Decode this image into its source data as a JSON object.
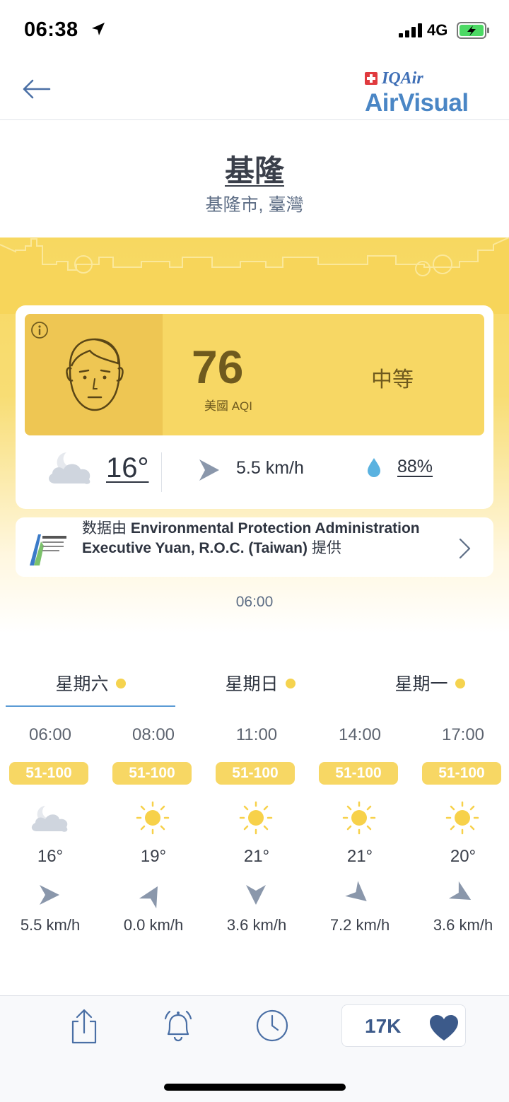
{
  "status_bar": {
    "time": "06:38",
    "network": "4G",
    "icons": [
      "location-arrow-icon",
      "signal-bars-icon",
      "battery-charging-icon"
    ]
  },
  "header": {
    "back_icon": "back-arrow-icon",
    "logo_top": "IQAir",
    "logo_bottom": "AirVisual",
    "colors": {
      "logo_blue": "#4a86c5",
      "flag_red": "#e03a3e"
    }
  },
  "location": {
    "city": "基隆",
    "region": "基隆市, 臺灣"
  },
  "aqi": {
    "value": "76",
    "unit": "美國 AQI",
    "level": "中等",
    "color": "#f7d764",
    "face_icon": "neutral-face-icon",
    "info_icon": "info-icon"
  },
  "current_weather": {
    "condition_icon": "partly-cloudy-night-icon",
    "temperature": "16°",
    "wind_icon": "wind-direction-icon",
    "wind_speed": "5.5 km/h",
    "humidity_icon": "water-drop-icon",
    "humidity": "88%"
  },
  "source": {
    "prefix": "数据由 ",
    "name": "Environmental Protection Administration Executive Yuan, R.O.C. (Taiwan)",
    "suffix": " 提供",
    "logo_icon": "epa-logo-icon",
    "chevron_icon": "chevron-right-icon"
  },
  "last_update": "06:00",
  "day_tabs": [
    {
      "label": "星期六",
      "active": true
    },
    {
      "label": "星期日",
      "active": false
    },
    {
      "label": "星期一",
      "active": false
    }
  ],
  "hourly": [
    {
      "time": "06:00",
      "aqi_range": "51-100",
      "icon": "partly-cloudy-night-icon",
      "temp": "16°",
      "wind": "5.5 km/h",
      "wind_dir_deg": 0
    },
    {
      "time": "08:00",
      "aqi_range": "51-100",
      "icon": "sun-icon",
      "temp": "19°",
      "wind": "0.0 km/h",
      "wind_dir_deg": -60
    },
    {
      "time": "11:00",
      "aqi_range": "51-100",
      "icon": "sun-icon",
      "temp": "21°",
      "wind": "3.6 km/h",
      "wind_dir_deg": 90
    },
    {
      "time": "14:00",
      "aqi_range": "51-100",
      "icon": "sun-icon",
      "temp": "21°",
      "wind": "7.2 km/h",
      "wind_dir_deg": 40
    },
    {
      "time": "17:00",
      "aqi_range": "51-100",
      "icon": "sun-icon",
      "temp": "20°",
      "wind": "3.6 km/h",
      "wind_dir_deg": 30
    }
  ],
  "bottom_bar": {
    "share_icon": "share-icon",
    "alert_icon": "bell-alert-icon",
    "history_icon": "clock-icon",
    "likes": "17K",
    "heart_icon": "heart-icon"
  }
}
